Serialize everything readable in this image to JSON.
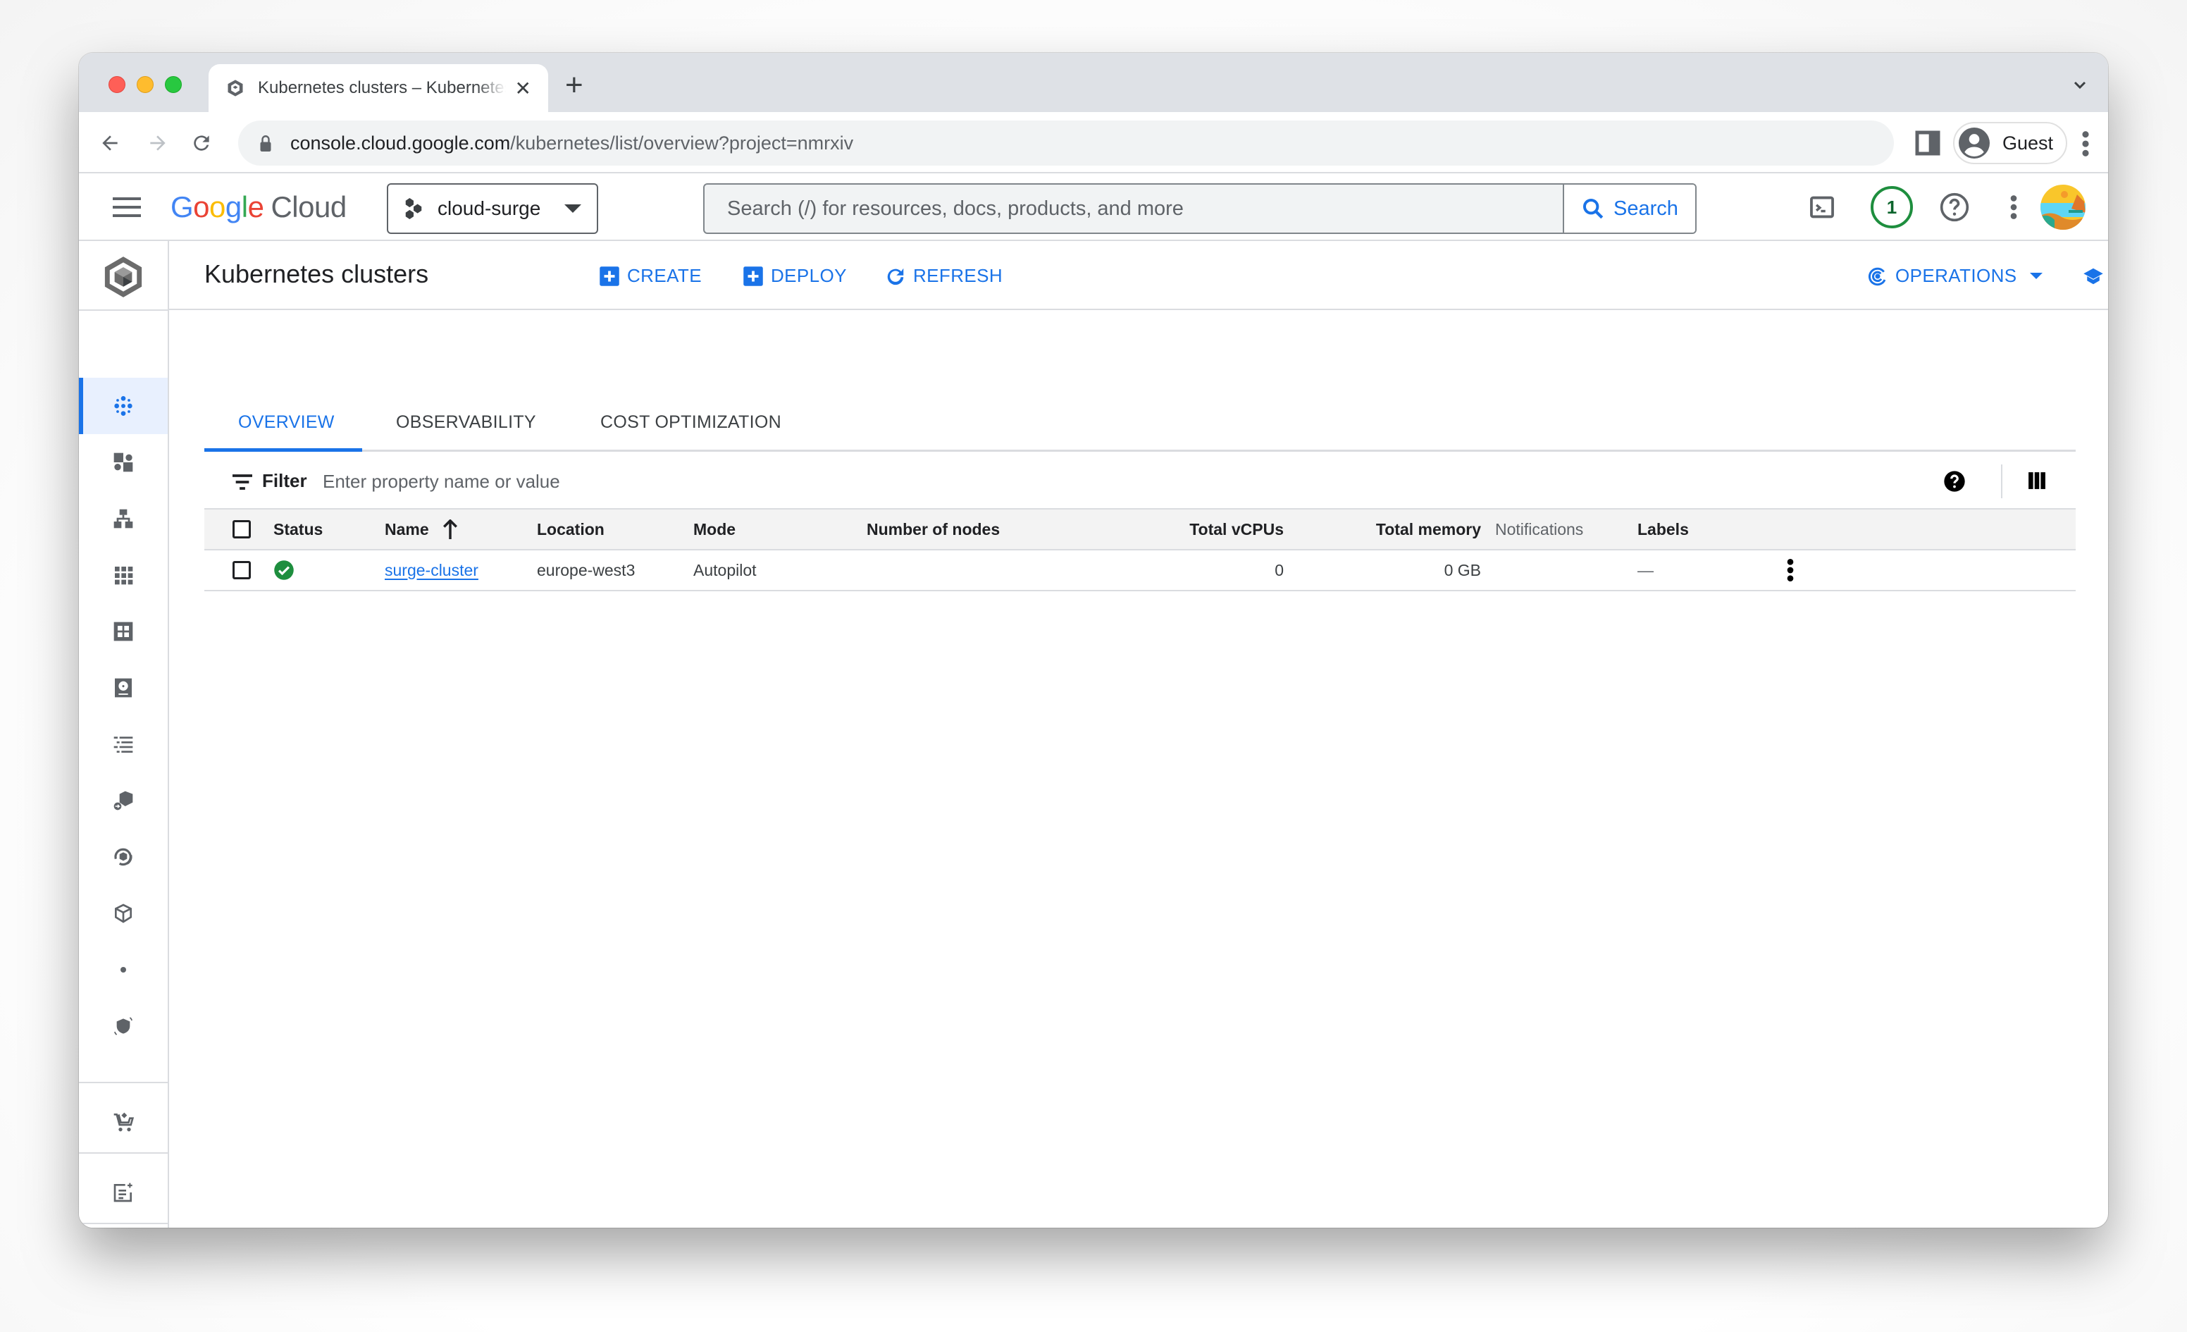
{
  "browser": {
    "tab_title": "Kubernetes clusters – Kubernetes Engine",
    "url_host": "console.cloud.google.com",
    "url_path": "/kubernetes/list/overview?project=nmrxiv",
    "profile_label": "Guest"
  },
  "header": {
    "logo_letters": [
      "G",
      "o",
      "o",
      "g",
      "l",
      "e"
    ],
    "logo_product": "Cloud",
    "project_name": "cloud-surge",
    "search_placeholder": "Search (/) for resources, docs, products, and more",
    "search_button": "Search",
    "notification_count": "1"
  },
  "page": {
    "title": "Kubernetes clusters",
    "actions": {
      "create": "CREATE",
      "deploy": "DEPLOY",
      "refresh": "REFRESH",
      "operations": "OPERATIONS",
      "learn": "LEARN"
    },
    "tabs": [
      {
        "label": "OVERVIEW",
        "active": true
      },
      {
        "label": "OBSERVABILITY",
        "active": false
      },
      {
        "label": "COST OPTIMIZATION",
        "active": false
      }
    ],
    "filter": {
      "label": "Filter",
      "placeholder": "Enter property name or value"
    }
  },
  "sidebar": {
    "items": [
      {
        "icon": "clusters-icon",
        "active": true
      },
      {
        "icon": "workloads-icon"
      },
      {
        "icon": "services-ingress-icon"
      },
      {
        "icon": "applications-icon"
      },
      {
        "icon": "secrets-configmaps-icon"
      },
      {
        "icon": "storage-icon"
      },
      {
        "icon": "object-browser-icon"
      },
      {
        "icon": "migrate-to-containers-icon"
      },
      {
        "icon": "backup-for-gke-icon"
      },
      {
        "icon": "config-icon"
      },
      {
        "icon": "dot-icon"
      },
      {
        "icon": "security-posture-icon"
      },
      {
        "icon": "marketplace-icon"
      },
      {
        "icon": "release-notes-icon"
      },
      {
        "icon": "expand-sidebar-icon"
      }
    ]
  },
  "table": {
    "columns": [
      {
        "key": "status",
        "label": "Status"
      },
      {
        "key": "name",
        "label": "Name",
        "sorted": "ascending"
      },
      {
        "key": "location",
        "label": "Location"
      },
      {
        "key": "mode",
        "label": "Mode"
      },
      {
        "key": "nodes",
        "label": "Number of nodes"
      },
      {
        "key": "vcpus",
        "label": "Total vCPUs"
      },
      {
        "key": "memory",
        "label": "Total memory"
      },
      {
        "key": "notifications",
        "label": "Notifications"
      },
      {
        "key": "labels",
        "label": "Labels"
      }
    ],
    "rows": [
      {
        "status": "ok",
        "name": "surge-cluster",
        "location": "europe-west3",
        "mode": "Autopilot",
        "nodes": "",
        "vcpus": "0",
        "memory": "0 GB",
        "notifications": "",
        "labels": "—"
      }
    ]
  },
  "colors": {
    "accent": "#1a73e8",
    "status_ok": "#1e8e3e"
  }
}
